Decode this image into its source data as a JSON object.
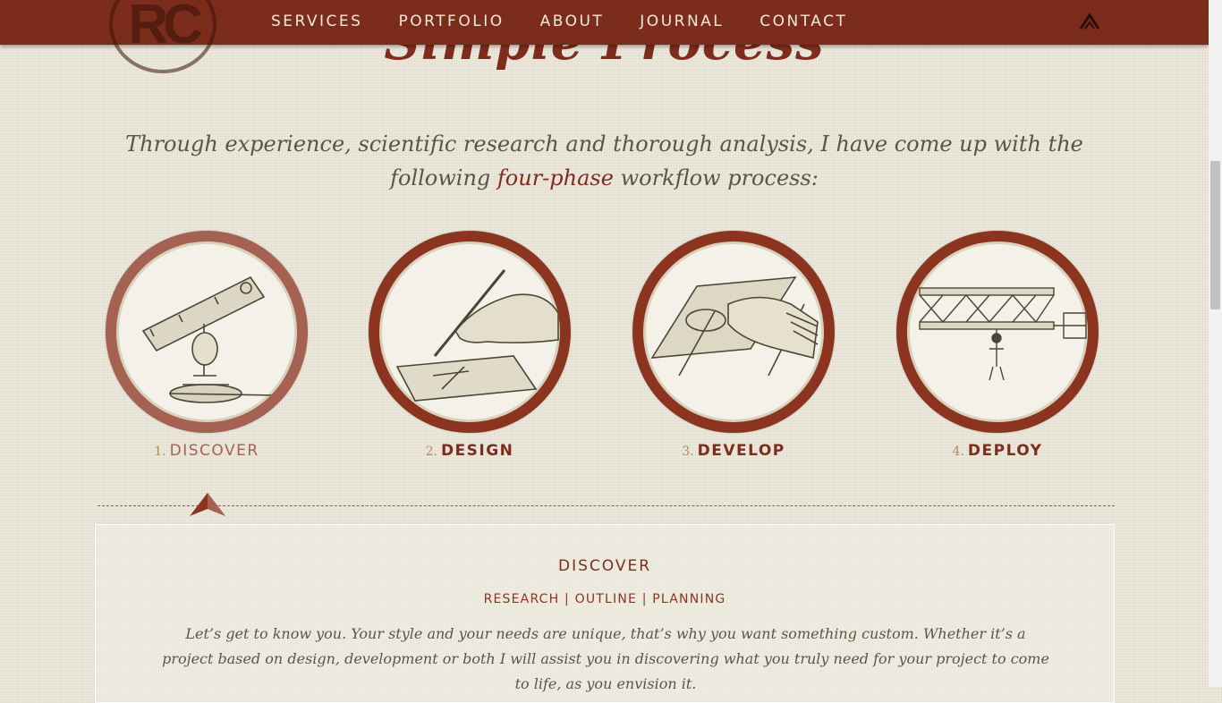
{
  "nav": {
    "logo_text": "RC",
    "items": [
      {
        "label": "SERVICES"
      },
      {
        "label": "PORTFOLIO"
      },
      {
        "label": "ABOUT"
      },
      {
        "label": "JOURNAL"
      },
      {
        "label": "CONTACT"
      }
    ],
    "back_to_top_icon": "caret-up-icon"
  },
  "section": {
    "heading": "Simple Process",
    "intro_before": "Through experience, scientific research and thorough analysis, I have come up with the following ",
    "intro_highlight": "four-phase",
    "intro_after": " workflow process:"
  },
  "steps": [
    {
      "number": "1.",
      "label": "DISCOVER",
      "icon": "telescope-illustration",
      "active": true
    },
    {
      "number": "2.",
      "label": "DESIGN",
      "icon": "drawing-hand-illustration",
      "active": false
    },
    {
      "number": "3.",
      "label": "DEVELOP",
      "icon": "hand-tool-illustration",
      "active": false
    },
    {
      "number": "4.",
      "label": "DEPLOY",
      "icon": "flying-machine-illustration",
      "active": false
    }
  ],
  "panel": {
    "title": "DISCOVER",
    "subtitle": "RESEARCH | OUTLINE | PLANNING",
    "body": "Let’s get to know you. Your style and your needs are unique, that’s why you want something custom. Whether it’s a project based on design, development or both I will assist you in discovering what you truly need for your project to come to life, as you envision it."
  },
  "colors": {
    "brand": "#7e2d1d",
    "active_ring": "#a56152",
    "text": "#5a5645",
    "background": "#ebe8dc"
  }
}
